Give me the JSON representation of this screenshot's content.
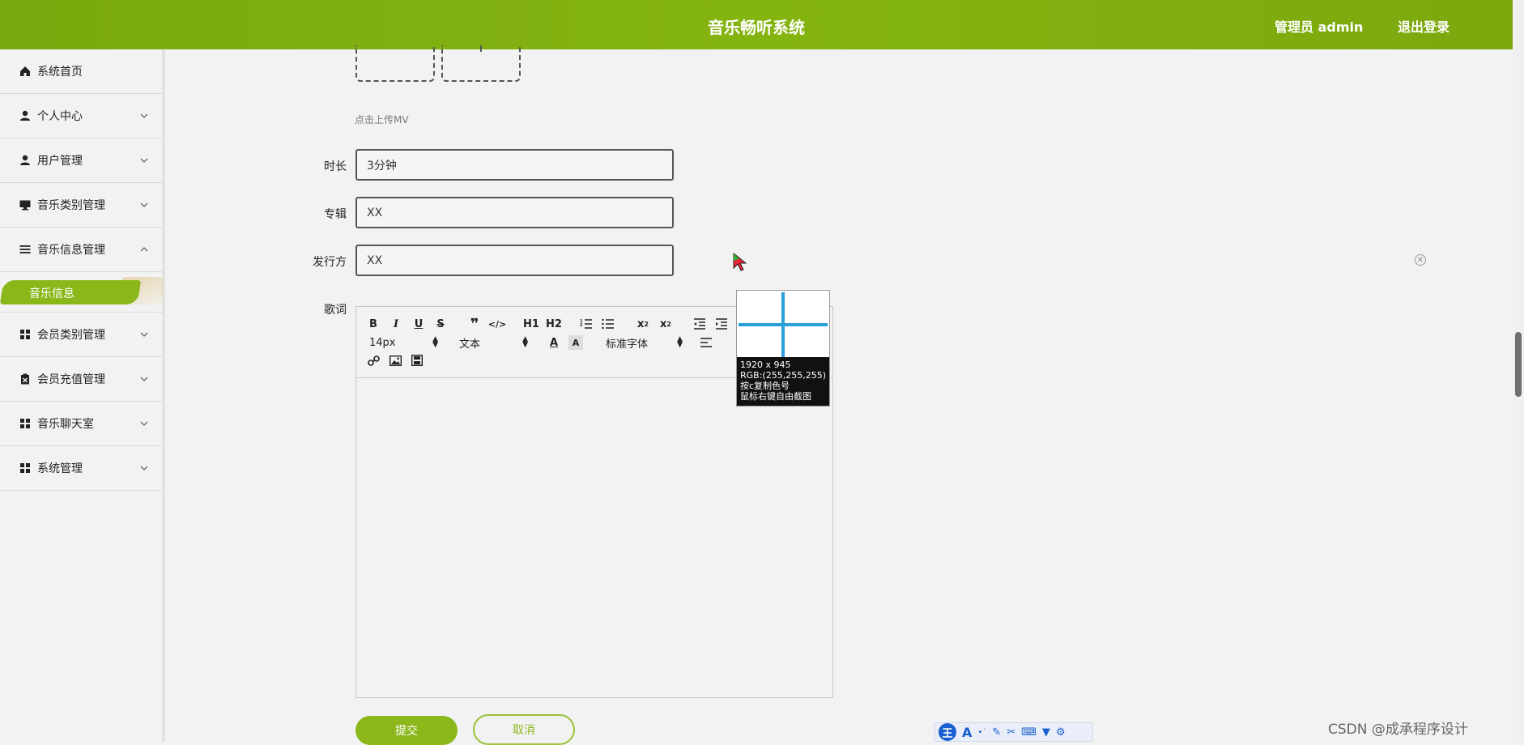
{
  "header": {
    "app_title": "音乐畅听系统",
    "admin_label": "管理员 admin",
    "logout_label": "退出登录"
  },
  "sidebar": {
    "items": [
      {
        "label": "系统首页",
        "icon": "home-icon",
        "chevron": false
      },
      {
        "label": "个人中心",
        "icon": "user-icon",
        "chevron": "down"
      },
      {
        "label": "用户管理",
        "icon": "user-icon",
        "chevron": "down"
      },
      {
        "label": "音乐类别管理",
        "icon": "monitor-icon",
        "chevron": "down"
      },
      {
        "label": "音乐信息管理",
        "icon": "list-icon",
        "chevron": "up"
      },
      {
        "label": "会员类别管理",
        "icon": "grid-icon",
        "chevron": "down"
      },
      {
        "label": "会员充值管理",
        "icon": "clipboard-icon",
        "chevron": "down"
      },
      {
        "label": "音乐聊天室",
        "icon": "grid-icon",
        "chevron": "down"
      },
      {
        "label": "系统管理",
        "icon": "grid-icon",
        "chevron": "down"
      }
    ],
    "active_sub": "音乐信息"
  },
  "form": {
    "upload_hint": "点击上传MV",
    "duration_label": "时长",
    "duration_value": "3分钟",
    "album_label": "专辑",
    "album_value": "XX",
    "publisher_label": "发行方",
    "publisher_value": "XX",
    "lyrics_label": "歌词",
    "submit_label": "提交",
    "cancel_label": "取消"
  },
  "editor_toolbar": {
    "font_size": "14px",
    "text_type": "文本",
    "font_family": "标准字体",
    "h1": "H1",
    "h2": "H2"
  },
  "color_picker": {
    "size": "1920 x 945",
    "rgb": "RGB:(255,255,255)",
    "hint1": "按c复制色号",
    "hint2": "鼠标右键自由截图"
  },
  "ime": {
    "label": "王"
  },
  "watermark": "CSDN @成承程序设计",
  "colors": {
    "brand_green": "#84b410",
    "accent_blue": "#2a9fd8"
  }
}
